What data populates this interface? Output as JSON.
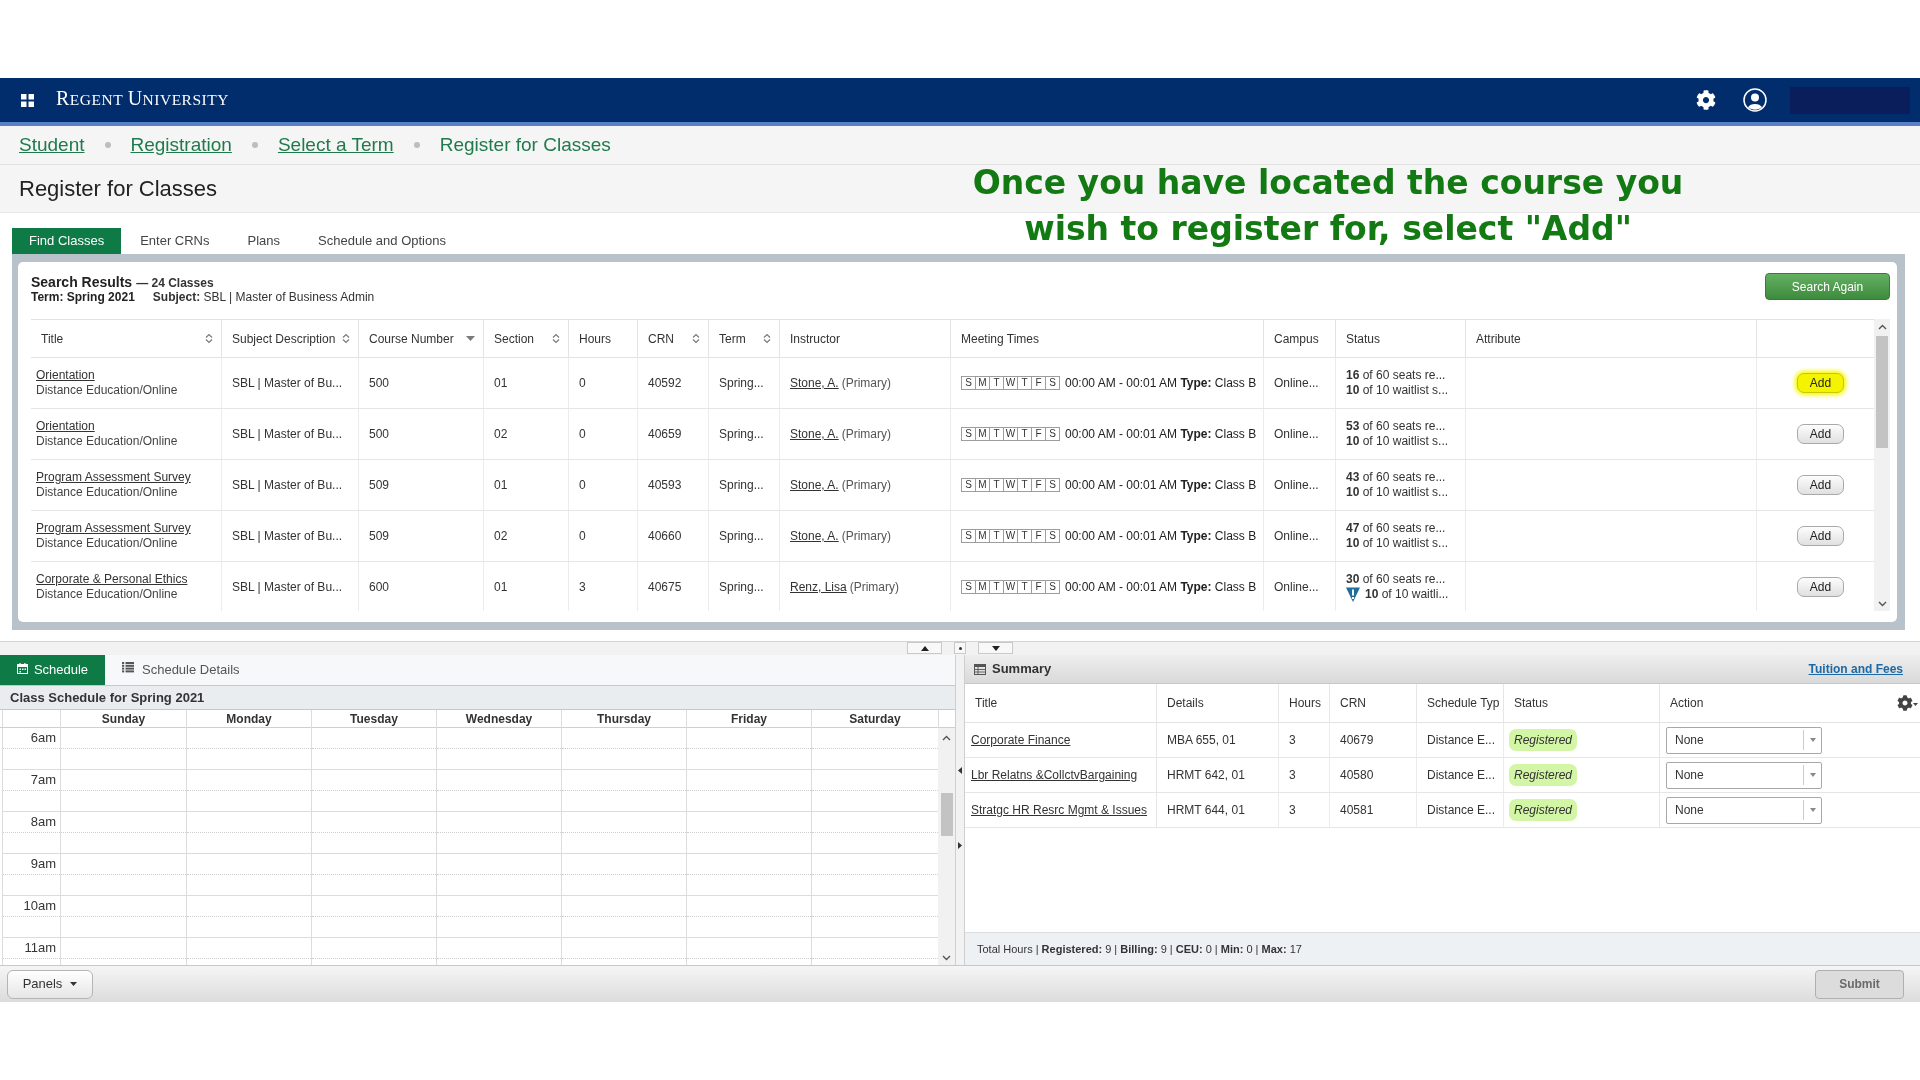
{
  "header": {
    "logo": "REGENT UNIVERSITY"
  },
  "breadcrumbs": [
    {
      "label": "Student",
      "current": false
    },
    {
      "label": "Registration",
      "current": false
    },
    {
      "label": "Select a Term",
      "current": false
    },
    {
      "label": "Register for Classes",
      "current": true
    }
  ],
  "page_title": "Register for Classes",
  "annotation": "Once you have located the course you wish to register for, select \"Add\"",
  "tabs": [
    {
      "label": "Find Classes",
      "selected": true
    },
    {
      "label": "Enter CRNs",
      "selected": false
    },
    {
      "label": "Plans",
      "selected": false
    },
    {
      "label": "Schedule and Options",
      "selected": false
    }
  ],
  "search_results": {
    "title": "Search Results",
    "count": "— 24 Classes",
    "term": "Term: Spring 2021",
    "subject": "**Subject:** SBL | Master of Business Admin",
    "search_again_button": "Search Again"
  },
  "results_table": {
    "columns": [
      {
        "label": "Title",
        "sortable": true,
        "sorted": false
      },
      {
        "label": "Subject Description",
        "sortable": true,
        "sorted": false
      },
      {
        "label": "Course Number",
        "sortable": true,
        "sorted": true
      },
      {
        "label": "Section",
        "sortable": true,
        "sorted": false
      },
      {
        "label": "Hours",
        "sortable": false
      },
      {
        "label": "CRN",
        "sortable": true,
        "sorted": false
      },
      {
        "label": "Term",
        "sortable": true,
        "sorted": false
      },
      {
        "label": "Instructor",
        "sortable": false
      },
      {
        "label": "Meeting Times",
        "sortable": false
      },
      {
        "label": "Campus",
        "sortable": false
      },
      {
        "label": "Status",
        "sortable": false
      },
      {
        "label": "Attribute",
        "sortable": false
      }
    ],
    "rows": [
      {
        "title": "Orientation",
        "delivery": "Distance Education/Online",
        "subject": "SBL | Master of Bu...",
        "course_number": "500",
        "section": "01",
        "hours": "0",
        "crn": "40592",
        "term": "Spring...",
        "instructor": "Stone, A.",
        "instructor_role": "(Primary)",
        "days": [
          "S",
          "M",
          "T",
          "W",
          "T",
          "F",
          "S"
        ],
        "meeting": "00:00 AM - 00:01 AM **Type:** Class B",
        "campus": "Online...",
        "seats": "**16** of 60 seats re...",
        "waitlist": "**10** of 10 waitlist s...",
        "waitlist_warning": false,
        "add_button": "Add",
        "highlighted": true
      },
      {
        "title": "Orientation",
        "delivery": "Distance Education/Online",
        "subject": "SBL | Master of Bu...",
        "course_number": "500",
        "section": "02",
        "hours": "0",
        "crn": "40659",
        "term": "Spring...",
        "instructor": "Stone, A.",
        "instructor_role": "(Primary)",
        "days": [
          "S",
          "M",
          "T",
          "W",
          "T",
          "F",
          "S"
        ],
        "meeting": "00:00 AM - 00:01 AM **Type:** Class B",
        "campus": "Online...",
        "seats": "**53** of 60 seats re...",
        "waitlist": "**10** of 10 waitlist s...",
        "waitlist_warning": false,
        "add_button": "Add",
        "highlighted": false
      },
      {
        "title": "Program Assessment Survey",
        "delivery": "Distance Education/Online",
        "subject": "SBL | Master of Bu...",
        "course_number": "509",
        "section": "01",
        "hours": "0",
        "crn": "40593",
        "term": "Spring...",
        "instructor": "Stone, A.",
        "instructor_role": "(Primary)",
        "days": [
          "S",
          "M",
          "T",
          "W",
          "T",
          "F",
          "S"
        ],
        "meeting": "00:00 AM - 00:01 AM **Type:** Class B",
        "campus": "Online...",
        "seats": "**43** of 60 seats re...",
        "waitlist": "**10** of 10 waitlist s...",
        "waitlist_warning": false,
        "add_button": "Add",
        "highlighted": false
      },
      {
        "title": "Program Assessment Survey",
        "delivery": "Distance Education/Online",
        "subject": "SBL | Master of Bu...",
        "course_number": "509",
        "section": "02",
        "hours": "0",
        "crn": "40660",
        "term": "Spring...",
        "instructor": "Stone, A.",
        "instructor_role": "(Primary)",
        "days": [
          "S",
          "M",
          "T",
          "W",
          "T",
          "F",
          "S"
        ],
        "meeting": "00:00 AM - 00:01 AM **Type:** Class B",
        "campus": "Online...",
        "seats": "**47** of 60 seats re...",
        "waitlist": "**10** of 10 waitlist s...",
        "waitlist_warning": false,
        "add_button": "Add",
        "highlighted": false
      },
      {
        "title": "Corporate & Personal Ethics",
        "delivery": "Distance Education/Online",
        "subject": "SBL | Master of Bu...",
        "course_number": "600",
        "section": "01",
        "hours": "3",
        "crn": "40675",
        "term": "Spring...",
        "instructor": "Renz, Lisa",
        "instructor_role": "(Primary)",
        "days": [
          "S",
          "M",
          "T",
          "W",
          "T",
          "F",
          "S"
        ],
        "meeting": "00:00 AM - 00:01 AM **Type:** Class B",
        "campus": "Online...",
        "seats": "**30** of 60 seats re...",
        "waitlist": "**10** of 10 waitli...",
        "waitlist_warning": true,
        "add_button": "Add",
        "highlighted": false
      }
    ]
  },
  "schedule_panel": {
    "tabs": [
      {
        "label": "Schedule",
        "selected": true
      },
      {
        "label": "Schedule Details",
        "selected": false
      }
    ],
    "title": "Class Schedule for Spring 2021",
    "days": [
      "Sunday",
      "Monday",
      "Tuesday",
      "Wednesday",
      "Thursday",
      "Friday",
      "Saturday"
    ],
    "times": [
      "6am",
      "7am",
      "8am",
      "9am",
      "10am",
      "11am"
    ]
  },
  "summary_panel": {
    "title": "Summary",
    "link": "Tuition and Fees",
    "columns": [
      "Title",
      "Details",
      "Hours",
      "CRN",
      "Schedule Typ",
      "Status",
      "Action"
    ],
    "rows": [
      {
        "title": "Corporate Finance",
        "details": "MBA 655, 01",
        "hours": "3",
        "crn": "40679",
        "schedule_type": "Distance E...",
        "status": "Registered",
        "action": "None"
      },
      {
        "title": "Lbr Relatns &CollctvBargaining",
        "details": "HRMT 642, 01",
        "hours": "3",
        "crn": "40580",
        "schedule_type": "Distance E...",
        "status": "Registered",
        "action": "None"
      },
      {
        "title": "Stratgc HR Resrc Mgmt & Issues",
        "details": "HRMT 644, 01",
        "hours": "3",
        "crn": "40581",
        "schedule_type": "Distance E...",
        "status": "Registered",
        "action": "None"
      }
    ],
    "totals": "Total Hours | **Registered:** 9 | **Billing:** 9 | **CEU:** 0 | **Min:** 0 | **Max:** 17"
  },
  "bottom_bar": {
    "panels_button": "Panels",
    "submit_button": {
      "label": "Submit",
      "disabled": true
    }
  }
}
